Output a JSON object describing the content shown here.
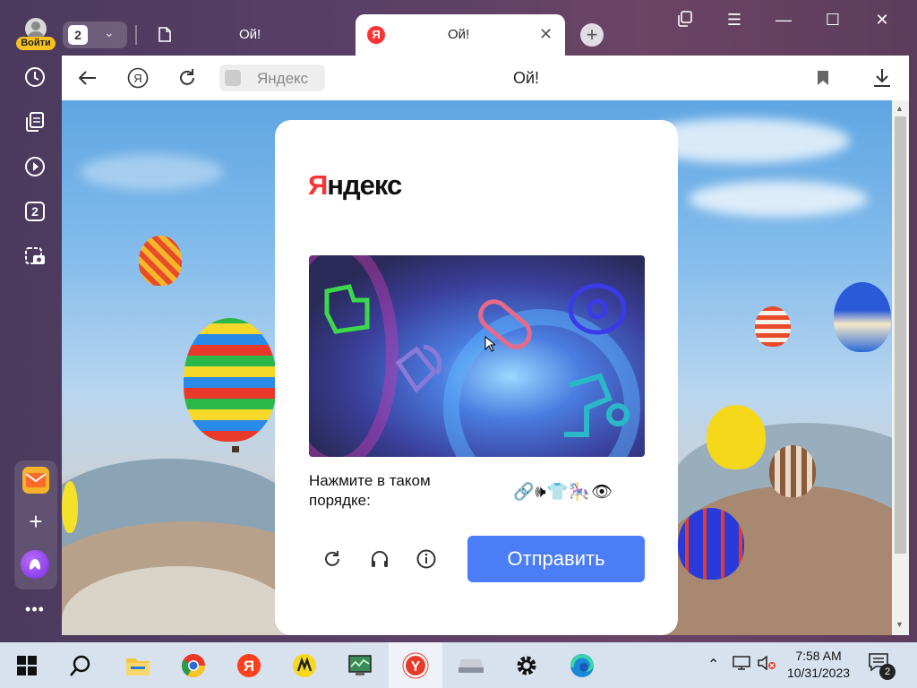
{
  "browser": {
    "profile": {
      "login_label": "Войти"
    },
    "tab_count": "2",
    "tabs": [
      {
        "title": "Ой!",
        "active": false
      },
      {
        "title": "Ой!",
        "active": true,
        "favicon_letter": "Я"
      }
    ],
    "new_tab_label": "+",
    "window_controls": {
      "minimize": "—",
      "maximize": "☐",
      "close": "✕"
    },
    "toolbar": {
      "domain": "Яндекс",
      "page_title": "Ой!"
    },
    "sidebar": {
      "tab_badge": "2",
      "more": "•••"
    }
  },
  "captcha": {
    "logo_red": "Я",
    "logo_rest": "ндекс",
    "instruction": "Нажмите в таком порядке:",
    "sequence": "🔗🕪👕🎠👁",
    "submit_label": "Отправить"
  },
  "taskbar": {
    "time": "7:58 AM",
    "date": "10/31/2023",
    "notification_count": "2"
  },
  "colors": {
    "accent_blue": "#4b7ef6",
    "yandex_red": "#ff3333",
    "login_yellow": "#f8c221"
  }
}
